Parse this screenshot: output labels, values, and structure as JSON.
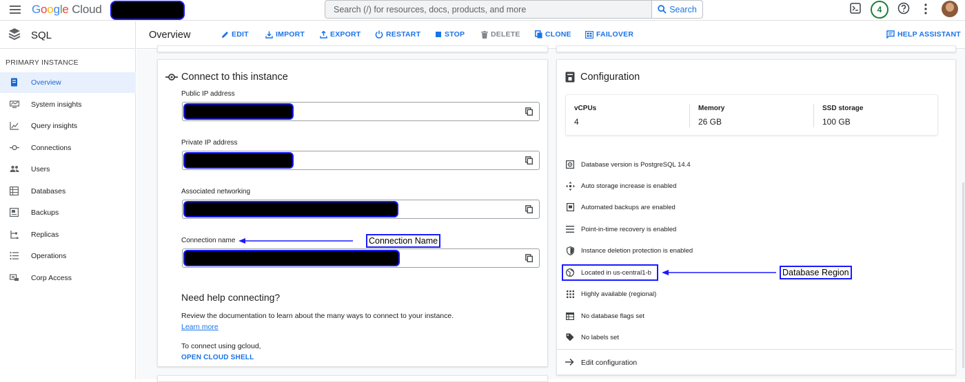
{
  "header": {
    "logo_parts": [
      "G",
      "o",
      "o",
      "g",
      "l",
      "e",
      " Cloud"
    ],
    "search_placeholder": "Search (/) for resources, docs, products, and more",
    "search_button": "Search",
    "notification_count": "4"
  },
  "sidebar": {
    "product_title": "SQL",
    "section_label": "PRIMARY INSTANCE",
    "items": [
      {
        "label": "Overview",
        "icon": "overview-icon",
        "active": true
      },
      {
        "label": "System insights",
        "icon": "system-insights-icon"
      },
      {
        "label": "Query insights",
        "icon": "query-insights-icon"
      },
      {
        "label": "Connections",
        "icon": "connections-icon"
      },
      {
        "label": "Users",
        "icon": "users-icon"
      },
      {
        "label": "Databases",
        "icon": "databases-icon"
      },
      {
        "label": "Backups",
        "icon": "backups-icon"
      },
      {
        "label": "Replicas",
        "icon": "replicas-icon"
      },
      {
        "label": "Operations",
        "icon": "operations-icon"
      },
      {
        "label": "Corp Access",
        "icon": "corp-access-icon"
      }
    ]
  },
  "toolbar": {
    "page_title": "Overview",
    "actions": {
      "edit": "EDIT",
      "import": "IMPORT",
      "export": "EXPORT",
      "restart": "RESTART",
      "stop": "STOP",
      "delete": "DELETE",
      "clone": "CLONE",
      "failover": "FAILOVER",
      "help_assistant": "HELP ASSISTANT"
    }
  },
  "connect": {
    "title": "Connect to this instance",
    "public_ip_label": "Public IP address",
    "private_ip_label": "Private IP address",
    "networking_label": "Associated networking",
    "connection_name_label": "Connection name",
    "connection_name_annotation": "Connection Name",
    "help_title": "Need help connecting?",
    "help_text": "Review the documentation to learn about the many ways to connect to your instance.",
    "learn_more": "Learn more",
    "gcloud_text": "To connect using gcloud,",
    "open_shell": "OPEN CLOUD SHELL"
  },
  "configuration": {
    "title": "Configuration",
    "stats": [
      {
        "label": "vCPUs",
        "value": "4"
      },
      {
        "label": "Memory",
        "value": "26 GB"
      },
      {
        "label": "SSD storage",
        "value": "100 GB"
      }
    ],
    "items": [
      {
        "text": "Database version is PostgreSQL 14.4",
        "icon": "database-version-icon"
      },
      {
        "text": "Auto storage increase is enabled",
        "icon": "auto-storage-icon"
      },
      {
        "text": "Automated backups are enabled",
        "icon": "automated-backups-icon"
      },
      {
        "text": "Point-in-time recovery is enabled",
        "icon": "point-in-time-icon"
      },
      {
        "text": "Instance deletion protection is enabled",
        "icon": "shield-icon"
      },
      {
        "text": "Located in us-central1-b",
        "icon": "globe-icon"
      },
      {
        "text": "Highly available (regional)",
        "icon": "grid-dots-icon"
      },
      {
        "text": "No database flags set",
        "icon": "table-icon"
      },
      {
        "text": "No labels set",
        "icon": "label-icon"
      }
    ],
    "region_annotation": "Database Region",
    "edit_configuration": "Edit configuration"
  }
}
